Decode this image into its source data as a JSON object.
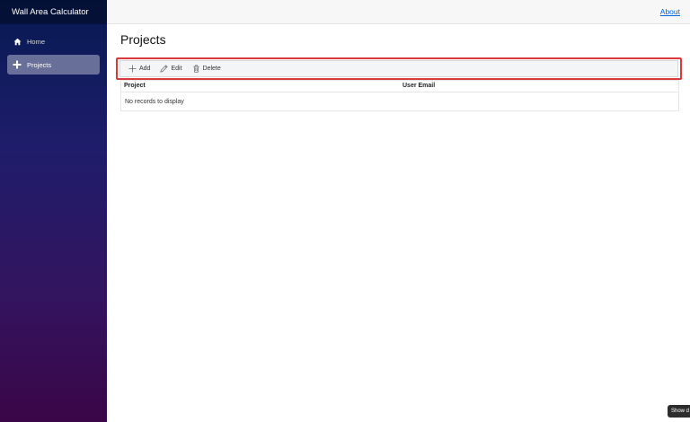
{
  "app": {
    "title": "Wall Area Calculator"
  },
  "nav": {
    "items": [
      {
        "label": "Home",
        "icon": "home-icon",
        "active": false
      },
      {
        "label": "Projects",
        "icon": "plus-icon",
        "active": true
      }
    ]
  },
  "topbar": {
    "about_label": "About"
  },
  "page": {
    "title": "Projects"
  },
  "toolbar": {
    "add_label": "Add",
    "edit_label": "Edit",
    "delete_label": "Delete",
    "highlight_color": "#d9393a"
  },
  "grid": {
    "columns": [
      "Project",
      "User Email"
    ],
    "empty_message": "No records to display"
  },
  "floating_tab": {
    "label": "Show d"
  },
  "colors": {
    "sidebar_top": "#061a52",
    "sidebar_bottom": "#3a0647",
    "link": "#0366d6"
  }
}
